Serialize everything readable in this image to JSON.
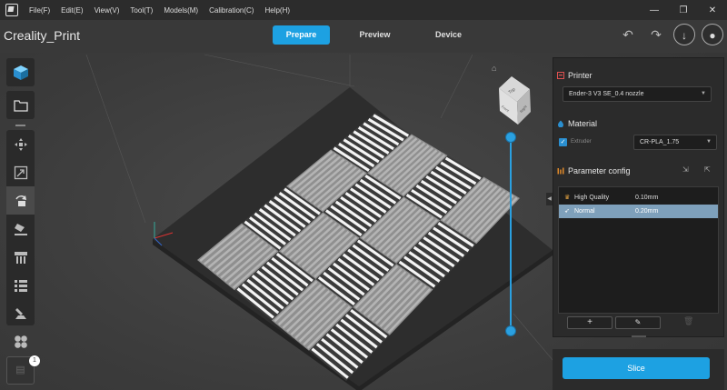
{
  "menu": {
    "items": [
      "File(F)",
      "Edit(E)",
      "View(V)",
      "Tool(T)",
      "Models(M)",
      "Calibration(C)",
      "Help(H)"
    ]
  },
  "window": {
    "minimize": "—",
    "restore": "❐",
    "close": "✕"
  },
  "app": {
    "title": "Creality_Print"
  },
  "tabs": [
    {
      "label": "Prepare",
      "active": true
    },
    {
      "label": "Preview",
      "active": false
    },
    {
      "label": "Device",
      "active": false
    }
  ],
  "icons": {
    "undo": "↶",
    "redo": "↷",
    "download": "↓",
    "user": "●",
    "home": "⌂",
    "add": "+",
    "edit": "✎",
    "delete": "🗑",
    "doc": "▤"
  },
  "cube": {
    "top": "Top",
    "front": "Front",
    "right": "Right"
  },
  "left_toolbar": {
    "tools": [
      "cube-add",
      "open-folder",
      "move",
      "scale",
      "rotate",
      "lay-flat",
      "support",
      "paint",
      "arrange"
    ]
  },
  "notification_count": "1",
  "printer": {
    "title": "Printer",
    "selected": "Ender-3 V3 SE_0.4 nozzle"
  },
  "material": {
    "title": "Material",
    "extruder_label": "Extruder",
    "selected": "CR-PLA_1.75"
  },
  "parameter": {
    "title": "Parameter config",
    "profiles": [
      {
        "name": "High Quality",
        "value": "0.10mm",
        "selected": false
      },
      {
        "name": "Normal",
        "value": "0.20mm",
        "selected": true
      }
    ]
  },
  "slice_label": "Slice",
  "colors": {
    "accent": "#1da1e2",
    "selected_row": "#7ea0bb",
    "panel": "#2b2b2b",
    "plate": "#2a2a2a"
  }
}
